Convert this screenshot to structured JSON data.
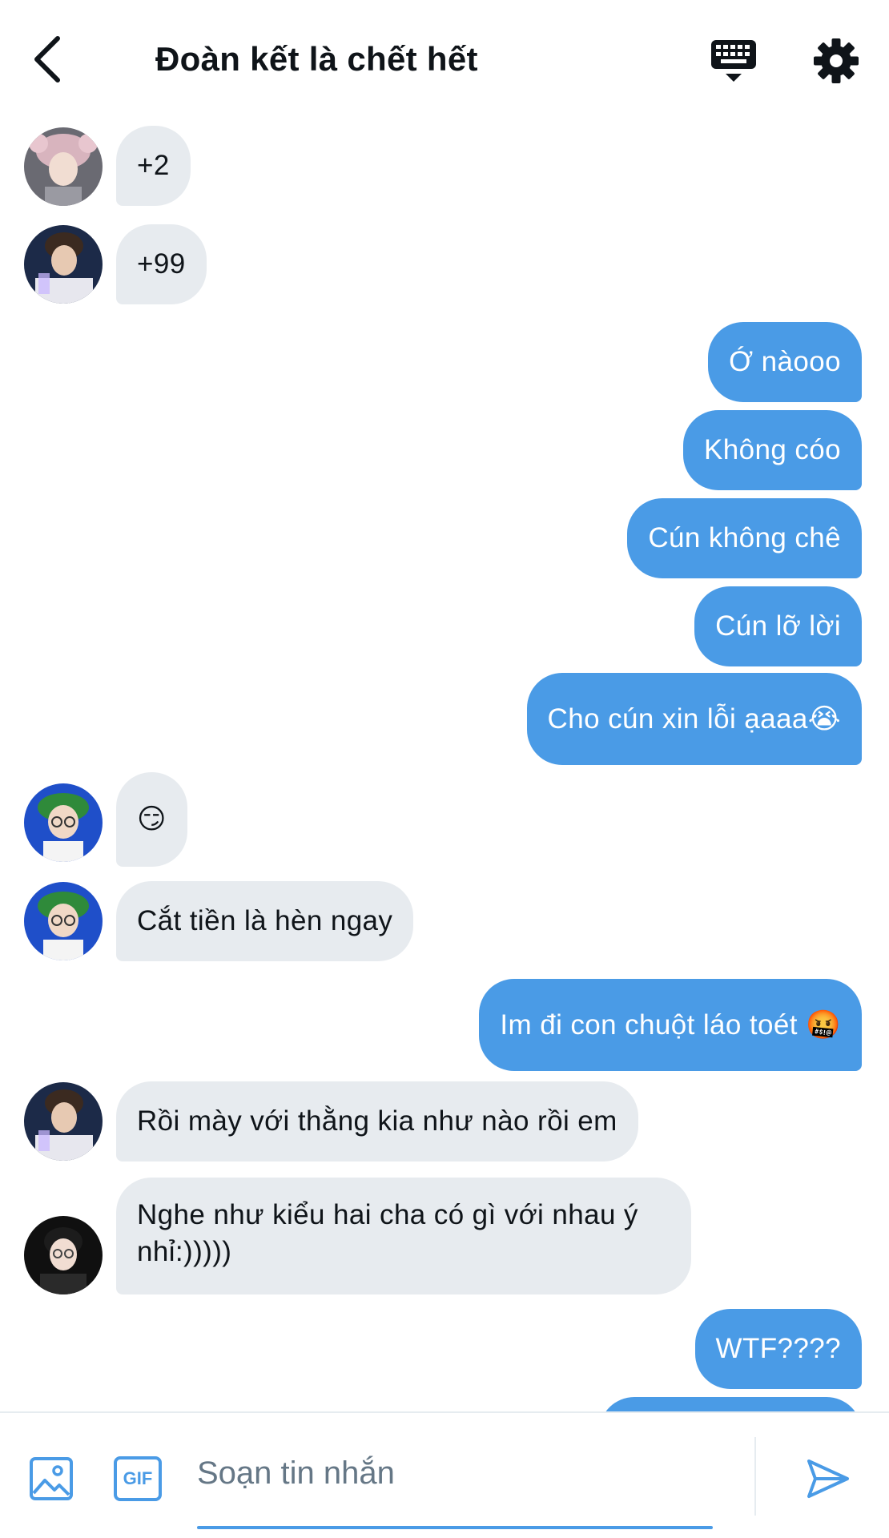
{
  "header": {
    "title": "Đoàn kết là chết hết",
    "icons": {
      "back": "chevron-left-icon",
      "keyboard": "keyboard-icon",
      "settings": "gear-icon"
    }
  },
  "messages": [
    {
      "direction": "incoming",
      "text": "+2"
    },
    {
      "direction": "incoming",
      "text": "+99"
    },
    {
      "direction": "outgoing",
      "text": "Ớ nàooo"
    },
    {
      "direction": "outgoing",
      "text": "Không cóo"
    },
    {
      "direction": "outgoing",
      "text": "Cún không chê"
    },
    {
      "direction": "outgoing",
      "text": "Cún lỡ lời"
    },
    {
      "direction": "outgoing",
      "text": "Cho cún xin lỗi ạaaa😭"
    },
    {
      "direction": "incoming",
      "text": "😏"
    },
    {
      "direction": "incoming",
      "text": "Cắt tiền là hèn ngay"
    },
    {
      "direction": "outgoing",
      "text": "Im đi con chuột láo toét 🤬"
    },
    {
      "direction": "incoming",
      "text": "Rồi mày với thằng kia như nào rồi em"
    },
    {
      "direction": "incoming",
      "text": "Nghe như kiểu hai cha có gì với nhau ý nhỉ:)))))"
    },
    {
      "direction": "outgoing",
      "text": "WTF????"
    }
  ],
  "composer": {
    "placeholder": "Soạn tin nhắn",
    "value": "",
    "gif_label": "GIF",
    "icons": {
      "image": "image-icon",
      "gif": "gif-icon",
      "send": "send-icon"
    }
  },
  "colors": {
    "accent": "#4a9be6",
    "incoming_bubble": "#e7ebef",
    "text": "#0f1419",
    "placeholder": "#657786"
  }
}
